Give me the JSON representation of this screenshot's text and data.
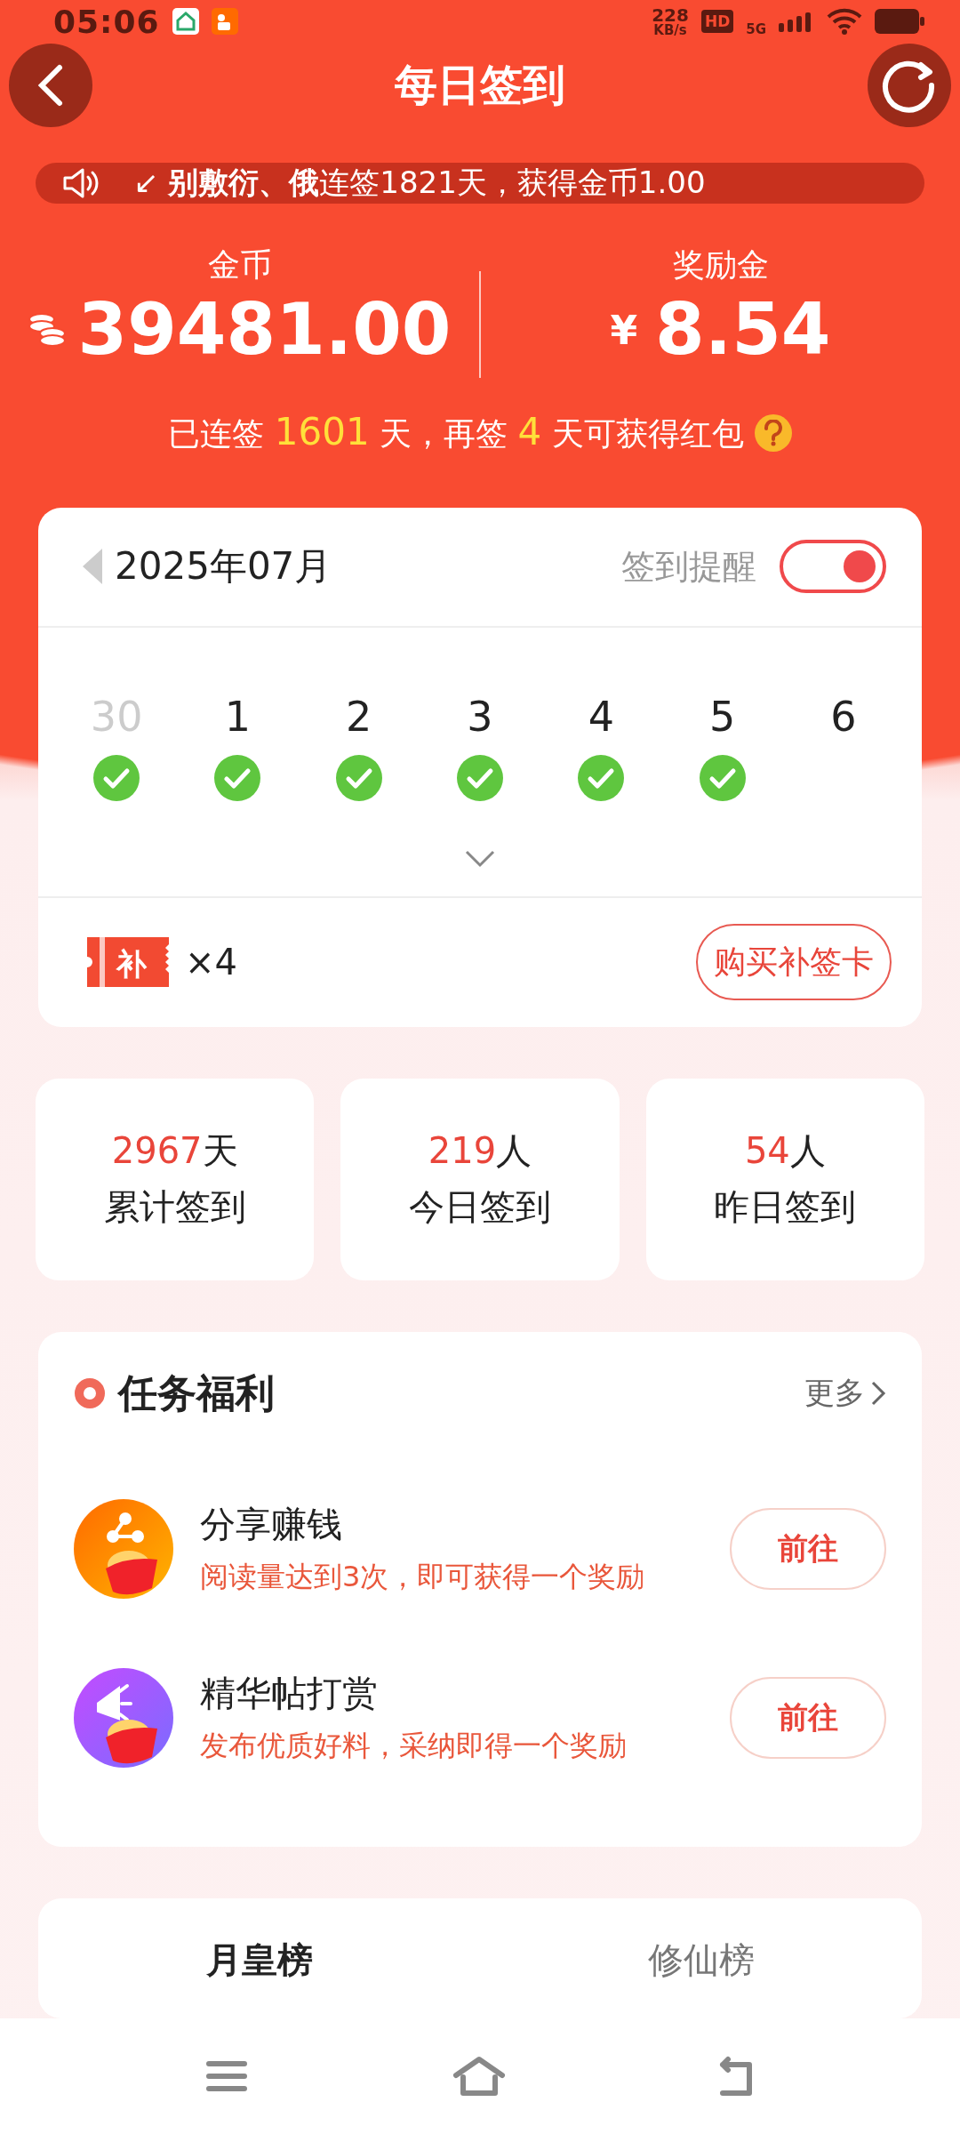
{
  "status_bar": {
    "time": "05:06",
    "speed_value": "228",
    "speed_unit": "KB/s",
    "hd": "HD",
    "network": "5G"
  },
  "header": {
    "title": "每日签到"
  },
  "notice": {
    "text": "↙ **别敷衍、俄**连签1821天，获得金币1.00"
  },
  "balances": [
    {
      "kind": "coins",
      "label": "金币",
      "value": "39481.00"
    },
    {
      "kind": "cash",
      "label": "奖励金",
      "prefix": "¥",
      "value": "8.54"
    }
  ],
  "streak": {
    "segments": [
      {
        "text": "已连签 ",
        "highlight": false
      },
      {
        "text": "1601",
        "highlight": true
      },
      {
        "text": " 天，再签 ",
        "highlight": false
      },
      {
        "text": "4",
        "highlight": true
      },
      {
        "text": " 天可获得红包",
        "highlight": false
      }
    ]
  },
  "calendar": {
    "month": "2025年07月",
    "reminder_label": "签到提醒",
    "reminder_on": true,
    "days": [
      {
        "day": "30",
        "other_month": true,
        "signed": true
      },
      {
        "day": "1",
        "other_month": false,
        "signed": true
      },
      {
        "day": "2",
        "other_month": false,
        "signed": true
      },
      {
        "day": "3",
        "other_month": false,
        "signed": true
      },
      {
        "day": "4",
        "other_month": false,
        "signed": true
      },
      {
        "day": "5",
        "other_month": false,
        "signed": true
      },
      {
        "day": "6",
        "other_month": false,
        "signed": false
      }
    ],
    "makeup_icon_text": "补",
    "makeup_count": "×4",
    "buy_button": "购买补签卡"
  },
  "stats": [
    {
      "value": "2967",
      "unit": "天",
      "label": "累计签到"
    },
    {
      "value": "219",
      "unit": "人",
      "label": "今日签到"
    },
    {
      "value": "54",
      "unit": "人",
      "label": "昨日签到"
    }
  ],
  "tasks": {
    "title": "任务福利",
    "more": "更多",
    "items": [
      {
        "kind": "share",
        "name": "分享赚钱",
        "desc": "阅读量达到3次，即可获得一个奖励",
        "button": "前往"
      },
      {
        "kind": "reward",
        "name": "精华帖打赏",
        "desc": "发布优质好料，采纳即得一个奖励",
        "button": "前往"
      }
    ]
  },
  "leaderboard": {
    "tabs": [
      {
        "label": "月皇榜",
        "selected": true
      },
      {
        "label": "修仙榜",
        "selected": false
      }
    ]
  }
}
